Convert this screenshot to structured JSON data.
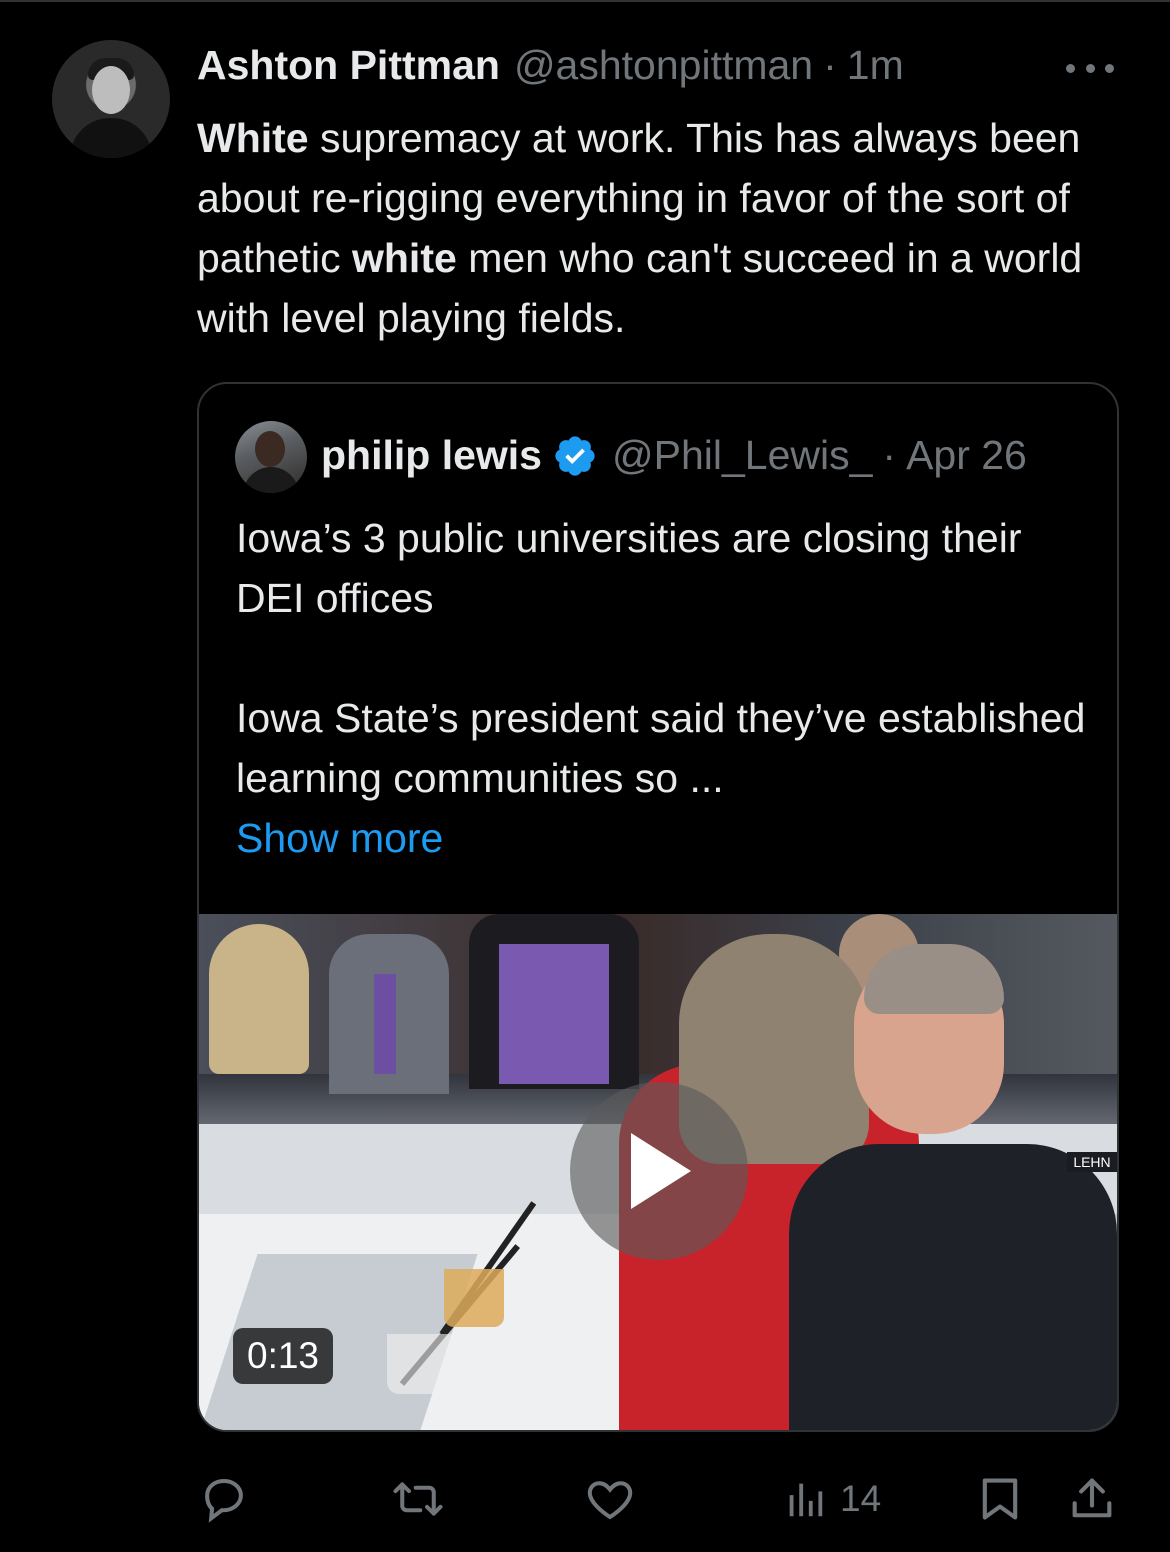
{
  "tweet": {
    "author_name": "Ashton Pittman",
    "author_handle": "@ashtonpittman",
    "separator": "·",
    "time": "1m",
    "text_parts": [
      {
        "text": "White",
        "bold": true
      },
      {
        "text": " supremacy at work. This has always been about re-rigging everything in favor of the sort of pathetic ",
        "bold": false
      },
      {
        "text": "white",
        "bold": true
      },
      {
        "text": " men who can't succeed in a world with level playing fields.",
        "bold": false
      }
    ]
  },
  "quote": {
    "author_name": "philip lewis",
    "author_handle": "@Phil_Lewis_",
    "separator": "·",
    "time": "Apr 26",
    "paragraph1": "Iowa’s 3 public universities are closing their DEI offices",
    "paragraph2": "Iowa State’s president said they’ve established learning communities so ...",
    "show_more": "Show more",
    "video_duration": "0:13",
    "nameplate": "LEHN"
  },
  "actions": {
    "views_count": "14"
  },
  "colors": {
    "background": "#000000",
    "text": "#e7e9ea",
    "muted": "#71767b",
    "link": "#1d9bf0",
    "border": "#2f3336",
    "verified": "#1d9bf0"
  },
  "icons": {
    "more": "more-dots-icon",
    "verified": "verified-badge-icon",
    "play": "play-icon",
    "reply": "reply-icon",
    "retweet": "retweet-icon",
    "like": "heart-icon",
    "views": "views-chart-icon",
    "bookmark": "bookmark-icon",
    "share": "share-icon"
  }
}
